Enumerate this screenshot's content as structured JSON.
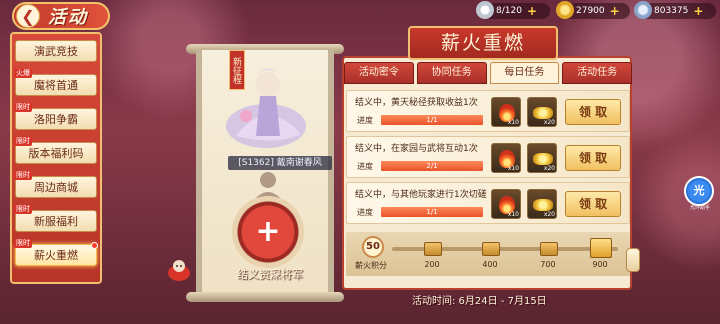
{
  "header": {
    "title": "活动",
    "back_icon": "back-arrow-icon",
    "resources": [
      {
        "icon": "silver-coin-icon",
        "value": "8/120"
      },
      {
        "icon": "gold-ingot-icon",
        "value": "27900"
      },
      {
        "icon": "jade-icon",
        "value": "803375"
      }
    ]
  },
  "sidebar": {
    "items": [
      {
        "label": "演武竞技",
        "tag": ""
      },
      {
        "label": "魔将首通",
        "tag": "火爆"
      },
      {
        "label": "洛阳争霸",
        "tag": "限时"
      },
      {
        "label": "版本福利码",
        "tag": "限时"
      },
      {
        "label": "周边商城",
        "tag": "限时"
      },
      {
        "label": "新服福利",
        "tag": "限时"
      },
      {
        "label": "薪火重燃",
        "tag": "限时",
        "active": true
      }
    ]
  },
  "scroll": {
    "badge": "新征程",
    "hero_label": "[S1362] 戴南谢春风",
    "caption": "结义资深将军"
  },
  "panel": {
    "title": "薪火重燃",
    "tabs": [
      "活动密令",
      "协同任务",
      "每日任务",
      "活动任务"
    ],
    "active_tab": 2,
    "progress_label": "进度",
    "claim_label": "领 取",
    "tasks": [
      {
        "desc": "结义中，黄天秘径获取收益1次",
        "progress_text": "1/1",
        "progress": 1.0,
        "rewards": [
          {
            "icon": "fire-icon",
            "count": "x10"
          },
          {
            "icon": "gold-ingot-icon",
            "count": "x20"
          }
        ]
      },
      {
        "desc": "结义中，在家园与武将互动1次",
        "progress_text": "2/1",
        "progress": 1.0,
        "rewards": [
          {
            "icon": "fire-icon",
            "count": "x10"
          },
          {
            "icon": "gold-ingot-icon",
            "count": "x20"
          }
        ]
      },
      {
        "desc": "结义中，与其他玩家进行1次切磋",
        "progress_text": "1/1",
        "progress": 1.0,
        "rewards": [
          {
            "icon": "fire-icon",
            "count": "x10"
          },
          {
            "icon": "gold-ingot-icon",
            "count": "x20"
          }
        ]
      }
    ],
    "score": {
      "value": "50",
      "label": "薪火积分",
      "milestones": [
        "200",
        "400",
        "700",
        "900"
      ]
    },
    "event_time": "活动时间:  6月24日 - 7月15日"
  },
  "side_button": {
    "label": "光",
    "sub": "光环助手"
  }
}
